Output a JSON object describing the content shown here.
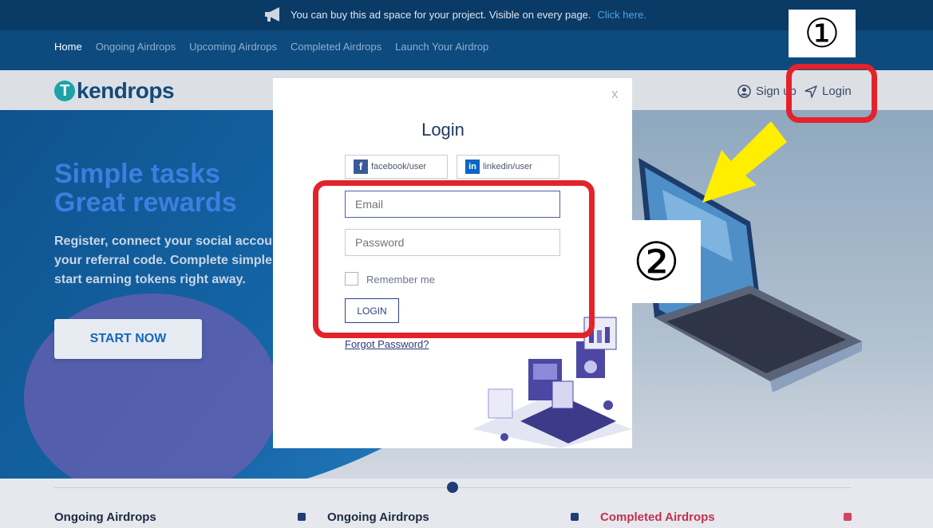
{
  "ad_bar": {
    "icon": "megaphone-icon",
    "text": "You can buy this ad space for your project. Visible on every page.",
    "link": "Click here."
  },
  "nav": {
    "items": [
      "Home",
      "Ongoing Airdrops",
      "Upcoming Airdrops",
      "Completed Airdrops",
      "Launch Your Airdrop"
    ]
  },
  "header": {
    "logo_text": "kendrops",
    "signup": "Sign up",
    "login": "Login"
  },
  "hero": {
    "headline_line1": "Simple tasks",
    "headline_line2": "Great rewards",
    "subtext": "Register, connect your social accou your referral code. Complete simple start earning tokens right away.",
    "cta": "START NOW"
  },
  "modal": {
    "close": "x",
    "title": "Login",
    "facebook": "facebook/user",
    "linkedin": "linkedin/user",
    "email_placeholder": "Email",
    "password_placeholder": "Password",
    "remember": "Remember me",
    "login_button": "LOGIN",
    "forgot": "Forgot Password?"
  },
  "bottom": {
    "sections": [
      "Ongoing Airdrops",
      "Ongoing Airdrops",
      "Completed Airdrops"
    ]
  },
  "annotations": {
    "marker1": "①",
    "marker2": "②"
  },
  "colors": {
    "annotation_red": "#e3232b",
    "arrow_yellow": "#ffee00",
    "brand_blue": "#0d4a7e"
  }
}
